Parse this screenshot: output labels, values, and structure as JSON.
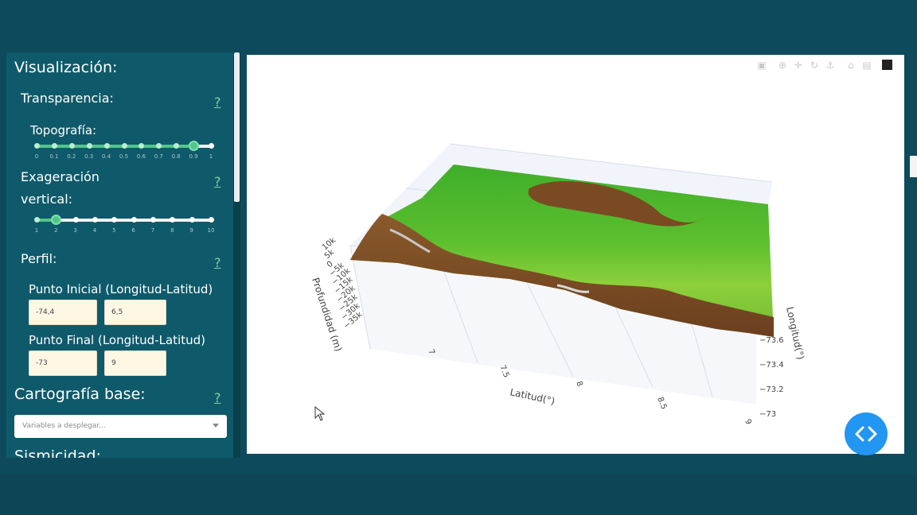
{
  "sidebar": {
    "title": "Visualización:",
    "help_label": "?",
    "transparency": {
      "heading": "Transparencia:",
      "topography_label": "Topografía:",
      "ticks": [
        "0",
        "0.1",
        "0.2",
        "0.3",
        "0.4",
        "0.5",
        "0.6",
        "0.7",
        "0.8",
        "0.9",
        "1"
      ],
      "value": 0.9
    },
    "exaggeration": {
      "heading_line1": "Exageración",
      "heading_line2": "vertical:",
      "ticks": [
        "1",
        "2",
        "3",
        "4",
        "5",
        "6",
        "7",
        "8",
        "9",
        "10"
      ],
      "value": 2
    },
    "profile": {
      "heading": "Perfil:",
      "start_label": "Punto Inicial (Longitud-Latitud)",
      "start_lon": "-74,4",
      "start_lat": "6,5",
      "end_label": "Punto Final (Longitud-Latitud)",
      "end_lon": "-73",
      "end_lat": "9"
    },
    "base_map": {
      "heading": "Cartografía base:",
      "placeholder": "Variables a desplegar..."
    },
    "next_section": "Sismicidad:"
  },
  "plot": {
    "z_axis_title": "Profundidad (m)",
    "z_ticks": [
      "10k",
      "5k",
      "0",
      "−5k",
      "−10k",
      "−15k",
      "−20k",
      "−25k",
      "−30k",
      "−35k"
    ],
    "x_axis_title": "Latitud(°)",
    "x_ticks": [
      "7",
      "7.5",
      "8",
      "8.5",
      "9"
    ],
    "y_axis_title": "Longitud(°)",
    "y_ticks": [
      "−73.6",
      "−73.4",
      "−73.2",
      "−73"
    ],
    "modebar_icons": [
      "camera-icon",
      "zoom-icon",
      "pan-icon",
      "orbit-icon",
      "turntable-icon",
      "home-icon",
      "camera-view-icon",
      "plotly-logo-icon"
    ]
  },
  "colors": {
    "background": "#0d4a5c",
    "sidebar": "#0f5a6a",
    "slider_fill": "#52c58a",
    "input_bg": "#fdf7e4",
    "code_button": "#2196f3"
  }
}
